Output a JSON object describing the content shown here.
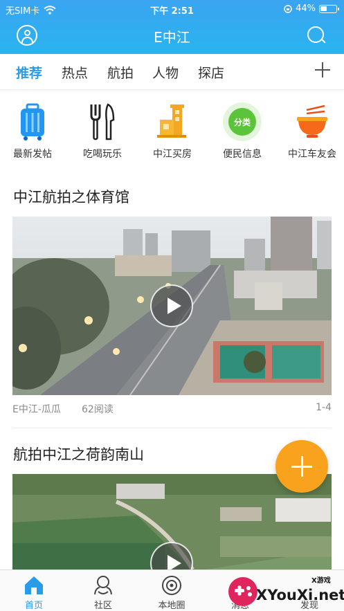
{
  "status_bar": {
    "carrier": "无SIM卡",
    "time": "下午 2:51",
    "battery": "44%"
  },
  "header": {
    "title": "E中江"
  },
  "tabs": [
    {
      "label": "推荐",
      "active": true
    },
    {
      "label": "热点",
      "active": false
    },
    {
      "label": "航拍",
      "active": false
    },
    {
      "label": "人物",
      "active": false
    },
    {
      "label": "探店",
      "active": false
    }
  ],
  "categories": [
    {
      "label": "最新发帖",
      "icon": "suitcase-icon"
    },
    {
      "label": "吃喝玩乐",
      "icon": "fork-knife-icon"
    },
    {
      "label": "中江买房",
      "icon": "house-icon"
    },
    {
      "label": "便民信息",
      "icon": "recycle-sort-icon",
      "badge": "分类"
    },
    {
      "label": "中江车友会",
      "icon": "noodle-bowl-icon"
    }
  ],
  "posts": [
    {
      "title": "中江航拍之体育馆",
      "author": "E中江-瓜瓜",
      "reads": "62阅读",
      "index": "1-4"
    },
    {
      "title": "航拍中江之荷韵南山"
    }
  ],
  "bottom_nav": [
    {
      "label": "首页",
      "icon": "home-icon",
      "active": true
    },
    {
      "label": "社区",
      "icon": "community-icon",
      "active": false
    },
    {
      "label": "本地圈",
      "icon": "local-circle-icon",
      "active": false
    },
    {
      "label": "消息",
      "icon": "message-icon",
      "active": false
    },
    {
      "label": "发现",
      "icon": "discover-icon",
      "active": false
    }
  ],
  "watermark": {
    "text": "XYouXi.net",
    "small": "X游戏"
  },
  "colors": {
    "accent": "#2a9be8",
    "header": "#34aaf0",
    "fab": "#f8a21e"
  }
}
